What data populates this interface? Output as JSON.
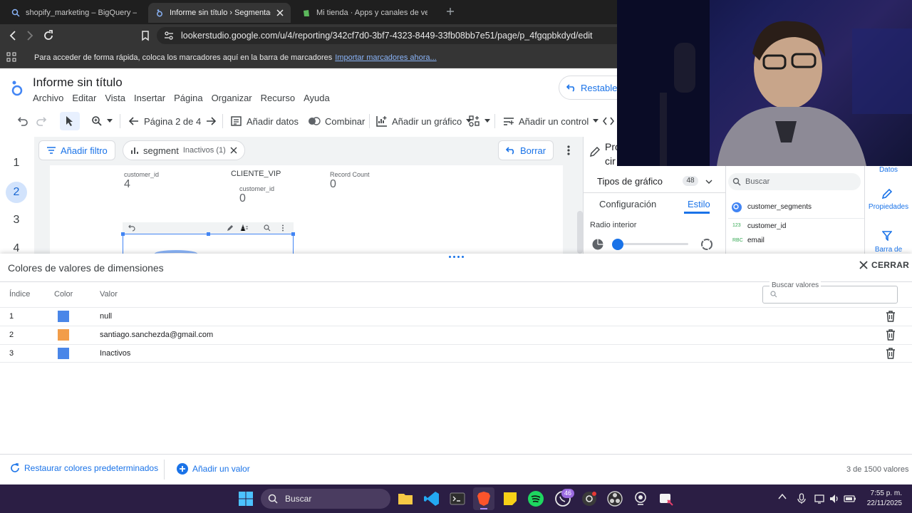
{
  "browser": {
    "tabs": [
      {
        "title": "shopify_marketing – BigQuery – Shop",
        "active": false
      },
      {
        "title": "Informe sin título › Segmentación",
        "active": true
      },
      {
        "title": "Mi tienda · Apps y canales de venta",
        "active": false
      }
    ],
    "url": "lookerstudio.google.com/u/4/reporting/342cf7d0-3bf7-4323-8449-33fb08bb7e51/page/p_4fgqpbkdyd/edit",
    "bookmarks_text": "Para acceder de forma rápida, coloca los marcadores aquí en la barra de marcadores",
    "bookmarks_link": "Importar marcadores ahora..."
  },
  "report": {
    "title": "Informe sin título",
    "menu": [
      "Archivo",
      "Editar",
      "Vista",
      "Insertar",
      "Página",
      "Organizar",
      "Recurso",
      "Ayuda"
    ],
    "reset_label": "Restablecer"
  },
  "toolbar": {
    "page_label": "Página 2 de 4",
    "add_data": "Añadir datos",
    "blend": "Combinar",
    "add_chart": "Añadir un gráfico",
    "add_control": "Añadir un control"
  },
  "pages": [
    "1",
    "2",
    "3",
    "4"
  ],
  "filters": {
    "add_filter": "Añadir filtro",
    "segment_label": "segment",
    "segment_value": "Inactivos (1)",
    "clear": "Borrar"
  },
  "canvas": {
    "scorecards": [
      {
        "caption": "customer_id",
        "value": "4"
      },
      {
        "heading": "CLIENTE_VIP",
        "caption": "customer_id",
        "value": "0"
      },
      {
        "caption": "Record Count",
        "value": "0"
      }
    ]
  },
  "properties": {
    "header": "Pro",
    "header2": "cir",
    "chart_types": "Tipos de gráfico",
    "chart_count": "48",
    "tab_config": "Configuración",
    "tab_style": "Estilo",
    "radius_label": "Radio interior",
    "search_placeholder": "Buscar",
    "datasource": "customer_segments",
    "fields": [
      {
        "type": "123",
        "name": "customer_id"
      },
      {
        "type": "RBC",
        "name": "email"
      }
    ],
    "side_data": "Datos",
    "side_props": "Propiedades",
    "side_filter": "Barra de"
  },
  "sheet": {
    "title": "Colores de valores de dimensiones",
    "close": "CERRAR",
    "col_index": "Índice",
    "col_color": "Color",
    "col_value": "Valor",
    "search_label": "Buscar valores",
    "rows": [
      {
        "index": "1",
        "color": "#4a86e8",
        "value": "null"
      },
      {
        "index": "2",
        "color": "#f29d49",
        "value": "santiago.sanchezda@gmail.com"
      },
      {
        "index": "3",
        "color": "#4a86e8",
        "value": "Inactivos"
      }
    ],
    "restore": "Restaurar colores predeterminados",
    "add_value": "Añadir un valor",
    "count": "3 de 1500 valores"
  },
  "taskbar": {
    "search": "Buscar",
    "badge": "46",
    "time": "7:55 p. m.",
    "date": "22/11/2025"
  }
}
